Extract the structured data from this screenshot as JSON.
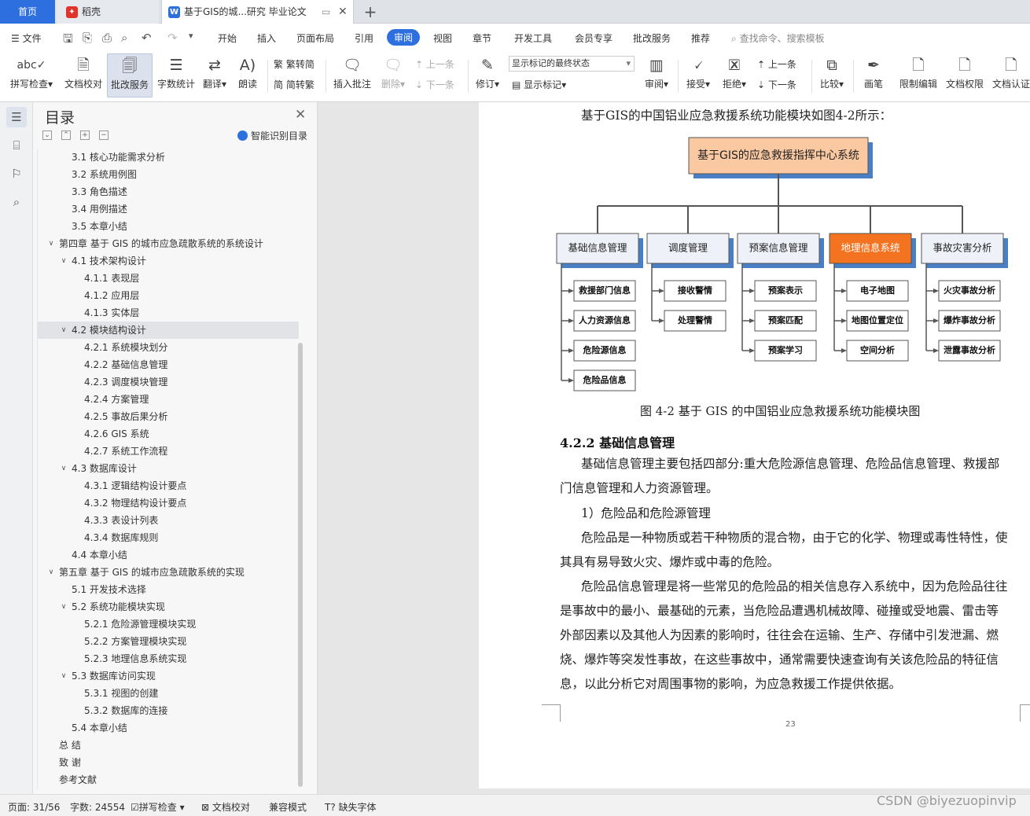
{
  "tabs": {
    "home": "首页",
    "daoke": "稻壳",
    "doc": "基于GIS的城...研究 毕业论文"
  },
  "menu": {
    "file": "文件",
    "items": [
      "开始",
      "插入",
      "页面布局",
      "引用",
      "审阅",
      "视图",
      "章节",
      "开发工具",
      "会员专享",
      "批改服务",
      "推荐"
    ],
    "active": "审阅",
    "search": "查找命令、搜索模板"
  },
  "ribbon": {
    "spellcheck": "拼写检查",
    "doccheck": "文档校对",
    "review_service": "批改服务",
    "wordcount": "字数统计",
    "translate": "翻译",
    "read": "朗读",
    "to_traditional": "繁转简",
    "to_simplified": "简转繁",
    "insert_comment": "插入批注",
    "delete": "删除",
    "prev": "上一条",
    "next": "下一条",
    "track": "修订",
    "markup_state": "显示标记的最终状态",
    "show_markup": "显示标记",
    "review_pane": "审阅",
    "accept": "接受",
    "reject": "拒绝",
    "prev2": "上一条",
    "next2": "下一条",
    "compare": "比较",
    "pen": "画笔",
    "restrict": "限制编辑",
    "doc_perm": "文档权限",
    "doc_cert": "文档认证"
  },
  "toc": {
    "title": "目录",
    "smart": "智能识别目录",
    "items": [
      {
        "text": "3.1  核心功能需求分析",
        "level": 2,
        "caret": ""
      },
      {
        "text": "3.2  系统用例图",
        "level": 2,
        "caret": ""
      },
      {
        "text": "3.3  角色描述",
        "level": 2,
        "caret": ""
      },
      {
        "text": "3.4  用例描述",
        "level": 2,
        "caret": ""
      },
      {
        "text": "3.5  本章小结",
        "level": 2,
        "caret": ""
      },
      {
        "text": "第四章  基于 GIS 的城市应急疏散系统的系统设计",
        "level": 1,
        "caret": "v"
      },
      {
        "text": "4.1    技术架构设计",
        "level": 2,
        "caret": "v"
      },
      {
        "text": "4.1.1  表现层",
        "level": 3,
        "caret": ""
      },
      {
        "text": "4.1.2  应用层",
        "level": 3,
        "caret": ""
      },
      {
        "text": "4.1.3  实体层",
        "level": 3,
        "caret": ""
      },
      {
        "text": "4.2  模块结构设计",
        "level": 2,
        "caret": "v",
        "selected": true
      },
      {
        "text": "4.2.1  系统模块划分",
        "level": 3,
        "caret": ""
      },
      {
        "text": "4.2.2  基础信息管理",
        "level": 3,
        "caret": ""
      },
      {
        "text": "4.2.3  调度模块管理",
        "level": 3,
        "caret": ""
      },
      {
        "text": "4.2.4  方案管理",
        "level": 3,
        "caret": ""
      },
      {
        "text": "4.2.5  事故后果分析",
        "level": 3,
        "caret": ""
      },
      {
        "text": "4.2.6 GIS 系统",
        "level": 3,
        "caret": ""
      },
      {
        "text": "4.2.7  系统工作流程",
        "level": 3,
        "caret": ""
      },
      {
        "text": "4.3  数据库设计",
        "level": 2,
        "caret": "v"
      },
      {
        "text": "4.3.1  逻辑结构设计要点",
        "level": 3,
        "caret": ""
      },
      {
        "text": "4.3.2  物理结构设计要点",
        "level": 3,
        "caret": ""
      },
      {
        "text": "4.3.3  表设计列表",
        "level": 3,
        "caret": ""
      },
      {
        "text": "4.3.4  数据库规则",
        "level": 3,
        "caret": ""
      },
      {
        "text": "4.4  本章小结",
        "level": 2,
        "caret": ""
      },
      {
        "text": "第五章  基于 GIS 的城市应急疏散系统的实现",
        "level": 1,
        "caret": "v"
      },
      {
        "text": "5.1  开发技术选择",
        "level": 2,
        "caret": ""
      },
      {
        "text": "5.2  系统功能模块实现",
        "level": 2,
        "caret": "v"
      },
      {
        "text": "5.2.1  危险源管理模块实现",
        "level": 3,
        "caret": ""
      },
      {
        "text": "5.2.2  方案管理模块实现",
        "level": 3,
        "caret": ""
      },
      {
        "text": "5.2.3  地理信息系统实现",
        "level": 3,
        "caret": ""
      },
      {
        "text": "5.3  数据库访问实现",
        "level": 2,
        "caret": "v"
      },
      {
        "text": "5.3.1  视图的创建",
        "level": 3,
        "caret": ""
      },
      {
        "text": "5.3.2  数据库的连接",
        "level": 3,
        "caret": ""
      },
      {
        "text": "5.4  本章小结",
        "level": 2,
        "caret": ""
      },
      {
        "text": "总    结",
        "level": 1,
        "caret": ""
      },
      {
        "text": "致    谢",
        "level": 1,
        "caret": ""
      },
      {
        "text": "参考文献",
        "level": 1,
        "caret": ""
      }
    ]
  },
  "doc": {
    "intro": "基于GIS的中国铝业应急救援系统功能模块如图4-2所示：",
    "diagram": {
      "root": "基于GIS的应急救援指挥中心系统",
      "modules": [
        {
          "name": "基础信息管理",
          "highlight": false,
          "children": [
            "救援部门信息",
            "人力资源信息",
            "危险源信息",
            "危险品信息"
          ]
        },
        {
          "name": "调度管理",
          "highlight": false,
          "children": [
            "接收警情",
            "处理警情"
          ]
        },
        {
          "name": "预案信息管理",
          "highlight": false,
          "children": [
            "预案表示",
            "预案匹配",
            "预案学习"
          ]
        },
        {
          "name": "地理信息系统",
          "highlight": true,
          "children": [
            "电子地图",
            "地图位置定位",
            "空间分析"
          ]
        },
        {
          "name": "事故灾害分析",
          "highlight": false,
          "children": [
            "火灾事故分析",
            "爆炸事故分析",
            "泄露事故分析"
          ]
        }
      ],
      "colors": {
        "root": "#fac9a1",
        "module": "#eef1f8",
        "highlight": "#f47320",
        "shadow": "#4a7fc6"
      }
    },
    "caption": "图 4-2    基于 GIS 的中国铝业应急救援系统功能模块图",
    "heading": "4.2.2  基础信息管理",
    "lines": [
      "基础信息管理主要包括四部分:重大危险源信息管理、危险品信息管理、救援部",
      "门信息管理和人力资源管理。",
      "1）危险品和危险源管理",
      "危险品是一种物质或若干种物质的混合物，由于它的化学、物理或毒性特性，使",
      "其具有易导致火灾、爆炸或中毒的危险。",
      "危险品信息管理是将一些常见的危险品的相关信息存入系统中，因为危险品往往",
      "是事故中的最小、最基础的元素，当危险品遭遇机械故障、碰撞或受地震、雷击等",
      "外部因素以及其他人为因素的影响时，往往会在运输、生产、存储中引发泄漏、燃",
      "烧、爆炸等突发性事故，在这些事故中，通常需要快速查询有关该危险品的特征信",
      "息，以此分析它对周围事物的影响，为应急救援工作提供依据。"
    ],
    "page_number": "23"
  },
  "status": {
    "page": "页面: 31/56",
    "words": "字数: 24554",
    "spell": "拼写检查",
    "doccheck": "文档校对",
    "compat": "兼容模式",
    "missing_font": "缺失字体"
  },
  "watermark": "CSDN @biyezuopinvip"
}
